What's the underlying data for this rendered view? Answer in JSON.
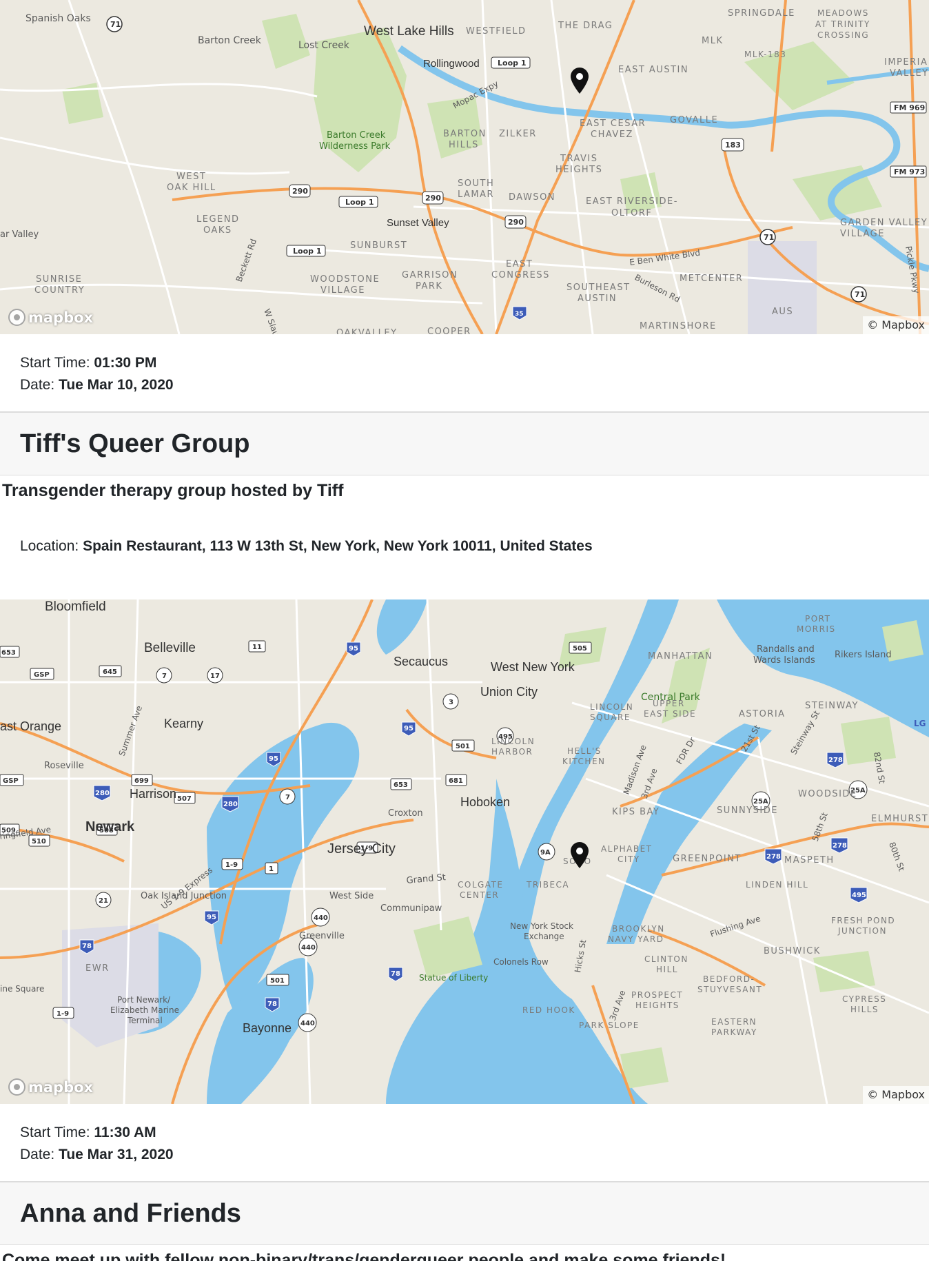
{
  "events": [
    {
      "map": {
        "attribution": "© Mapbox",
        "logo_text": "mapbox",
        "place_labels": [
          "Spanish Oaks",
          "Barton Creek",
          "Lost Creek",
          "West Lake Hills",
          "WESTFIELD",
          "THE DRAG",
          "SPRINGDALE",
          "MEADOWS AT TRINITY CROSSING",
          "Rollingwood",
          "EAST AUSTIN",
          "MLK",
          "MLK-183",
          "IMPERIAL VALLEY",
          "Barton Creek Wilderness Park",
          "BARTON HILLS",
          "ZILKER",
          "EAST CESAR CHAVEZ",
          "GOVALLE",
          "TRAVIS HEIGHTS",
          "WEST OAK HILL",
          "SOUTH LAMAR",
          "DAWSON",
          "EAST RIVERSIDE-OLTORF",
          "Sunset Valley",
          "LEGEND OAKS",
          "ar Valley",
          "SUNBURST",
          "GARDEN VALLEY VILLAGE",
          "SUNRISE COUNTRY",
          "WOODSTONE VILLAGE",
          "GARRISON PARK",
          "EAST CONGRESS",
          "SOUTHEAST AUSTIN",
          "METCENTER",
          "AUS",
          "MARTINSHORE",
          "E Ben White Blvd",
          "Burleson Rd",
          "Mopac Expy",
          "Beckett Rd",
          "W Slaughter",
          "Pickle Pkwy",
          "OAKVALLEY",
          "COOPER"
        ],
        "road_shields": [
          "71",
          "Loop 1",
          "290",
          "183",
          "FM 969",
          "FM 973",
          "35"
        ]
      },
      "start_time_label": "Start Time:",
      "start_time": "01:30 PM",
      "date_label": "Date:",
      "date": "Tue Mar 10, 2020"
    },
    {
      "title": "Tiff's Queer Group",
      "description": "Transgender therapy group hosted by Tiff",
      "location_label": "Location:",
      "location": "Spain Restaurant, 113 W 13th St, New York, New York 10011, United States",
      "map": {
        "attribution": "© Mapbox",
        "logo_text": "mapbox",
        "place_labels": [
          "Bloomfield",
          "Belleville",
          "Secaucus",
          "West New York",
          "MANHATTAN",
          "PORT MORRIS",
          "Randalls and Wards Islands",
          "Rikers Island",
          "Union City",
          "Central Park",
          "UPPER EAST SIDE",
          "LINCOLN SQUARE",
          "ast Orange",
          "Kearny",
          "STEINWAY",
          "ASTORIA",
          "LINCOLN HARBOR",
          "HELL'S KITCHEN",
          "Roseville",
          "Harrison",
          "Hoboken",
          "WOODSIDE",
          "Newark",
          "Croxton",
          "KIPS BAY",
          "SUNNYSIDE",
          "ELMHURST",
          "ringfield Ave",
          "Jersey City",
          "ALPHABET CITY",
          "SOHO",
          "GREENPOINT",
          "MASPETH",
          "Oak Island Junction",
          "Grand St",
          "West Side",
          "COLGATE CENTER",
          "TRIBECA",
          "LINDEN HILL",
          "Communipaw",
          "New York Stock Exchange",
          "BROOKLYN NAVY YARD",
          "FRESH POND JUNCTION",
          "Greenville",
          "Flushing Ave",
          "BUSHWICK",
          "EWR",
          "Colonels Row",
          "CLINTON HILL",
          "ine Square",
          "Statue of Liberty",
          "BEDFORD-STUYVESANT",
          "Port Newark/Elizabeth Marine Terminal",
          "PROSPECT HEIGHTS",
          "CYPRESS HILLS",
          "RED HOOK",
          "PARK SLOPE",
          "EASTERN PARKWAY",
          "Bayonne",
          "US 1-9 Express",
          "Summer Ave",
          "Madison Ave",
          "3rd Ave",
          "FDR Dr",
          "21st St",
          "Steinway St",
          "82nd St",
          "58th St",
          "80th St",
          "Hicks St"
        ],
        "road_shields": [
          "95",
          "505",
          "653",
          "GSP",
          "645",
          "7",
          "17",
          "11",
          "3",
          "495",
          "501",
          "699",
          "681",
          "280",
          "507",
          "278",
          "25A",
          "509",
          "508",
          "510",
          "1-9",
          "1",
          "9A",
          "21",
          "440",
          "78",
          "LGA"
        ]
      },
      "start_time_label": "Start Time:",
      "start_time": "11:30 AM",
      "date_label": "Date:",
      "date": "Tue Mar 31, 2020"
    },
    {
      "title": "Anna and Friends",
      "description": "Come meet up with fellow non-binary/trans/genderqueer people and make some friends!"
    }
  ],
  "colors": {
    "land": "#ece9e0",
    "park": "#cfe3b4",
    "water": "#83c5ec",
    "highway": "#f5a053",
    "road": "#ffffff",
    "header_bg": "#f7f7f7"
  }
}
